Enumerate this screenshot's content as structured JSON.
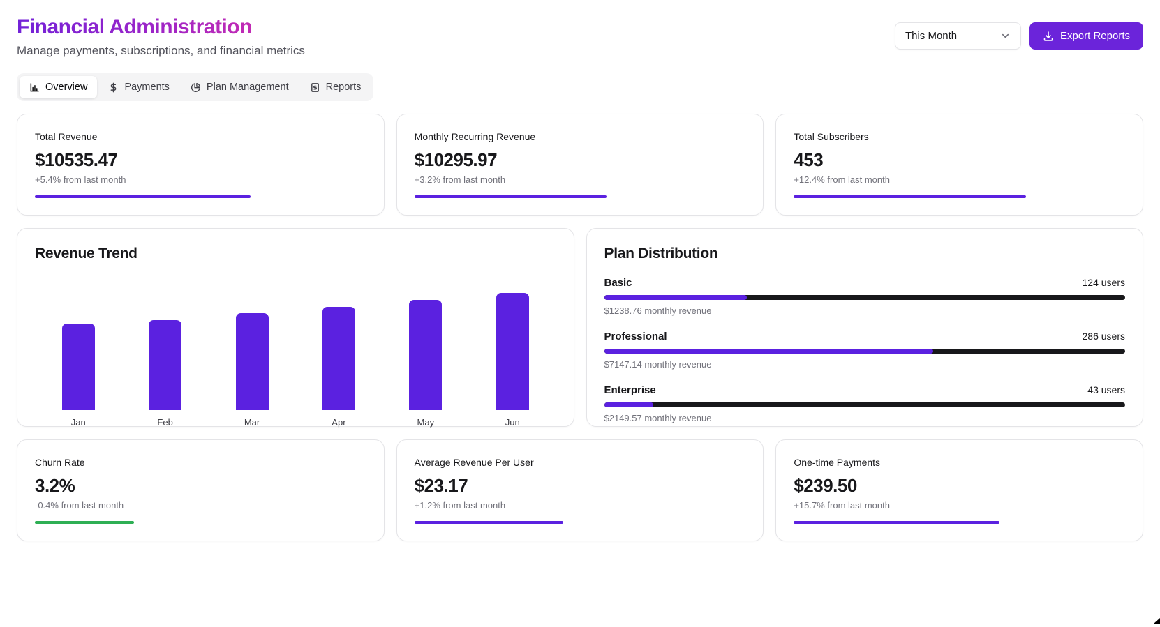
{
  "header": {
    "title": "Financial Administration",
    "subtitle": "Manage payments, subscriptions, and financial metrics",
    "period_selector": {
      "value": "This Month",
      "icon": "chevron-down-icon"
    },
    "export_button": {
      "label": "Export Reports",
      "icon": "download-icon",
      "color": "#6b24da"
    }
  },
  "tabs": [
    {
      "label": "Overview",
      "icon": "bar-chart-icon",
      "active": true
    },
    {
      "label": "Payments",
      "icon": "dollar-icon",
      "active": false
    },
    {
      "label": "Plan Management",
      "icon": "pie-chart-icon",
      "active": false
    },
    {
      "label": "Reports",
      "icon": "receipt-icon",
      "active": false
    }
  ],
  "stat_cards": [
    {
      "label": "Total Revenue",
      "value": "$10535.47",
      "change": "+5.4% from last month",
      "bar_percent": 65,
      "bar_color": "#5b21e0"
    },
    {
      "label": "Monthly Recurring Revenue",
      "value": "$10295.97",
      "change": "+3.2% from last month",
      "bar_percent": 58,
      "bar_color": "#5b21e0"
    },
    {
      "label": "Total Subscribers",
      "value": "453",
      "change": "+12.4% from last month",
      "bar_percent": 70,
      "bar_color": "#5b21e0"
    }
  ],
  "revenue_trend": {
    "title": "Revenue Trend"
  },
  "plan_distribution": {
    "title": "Plan Distribution",
    "plans": [
      {
        "name": "Basic",
        "users": "124 users",
        "revenue": "$1238.76 monthly revenue",
        "fill_percent": 27.4
      },
      {
        "name": "Professional",
        "users": "286 users",
        "revenue": "$7147.14 monthly revenue",
        "fill_percent": 63.2
      },
      {
        "name": "Enterprise",
        "users": "43 users",
        "revenue": "$2149.57 monthly revenue",
        "fill_percent": 9.5
      }
    ],
    "fill_color": "#5b21e0",
    "track_color": "#18181b"
  },
  "bottom_cards": [
    {
      "label": "Churn Rate",
      "value": "3.2%",
      "change": "-0.4% from last month",
      "bar_percent": 30,
      "bar_color": "#2eaf54"
    },
    {
      "label": "Average Revenue Per User",
      "value": "$23.17",
      "change": "+1.2% from last month",
      "bar_percent": 45,
      "bar_color": "#5b21e0"
    },
    {
      "label": "One-time Payments",
      "value": "$239.50",
      "change": "+15.7% from last month",
      "bar_percent": 62,
      "bar_color": "#5b21e0"
    }
  ],
  "chart_data": [
    {
      "type": "bar",
      "title": "Revenue Trend",
      "categories": [
        "Jan",
        "Feb",
        "Mar",
        "Apr",
        "May",
        "Jun"
      ],
      "values": [
        74,
        77,
        83,
        88,
        94,
        100
      ],
      "value_unit": "relative bar height percent (no y-axis shown)",
      "bar_color": "#5b21e0",
      "xlabel": "",
      "ylabel": "",
      "grid": false,
      "legend": false
    },
    {
      "type": "bar",
      "orientation": "horizontal",
      "title": "Plan Distribution",
      "categories": [
        "Basic",
        "Professional",
        "Enterprise"
      ],
      "values": [
        124,
        286,
        43
      ],
      "value_unit": "users",
      "total_users": 453,
      "monthly_revenue": [
        "$1238.76",
        "$7147.14",
        "$2149.57"
      ],
      "fill_color": "#5b21e0",
      "track_color": "#18181b",
      "legend": false
    }
  ],
  "colors": {
    "accent_purple": "#5b21e0",
    "button_purple": "#6b24da",
    "positive_green": "#2eaf54",
    "title_gradient_start": "#7222d8",
    "title_gradient_end": "#c22bb4",
    "card_border": "#e4e4e7",
    "muted_text": "#71717a"
  }
}
